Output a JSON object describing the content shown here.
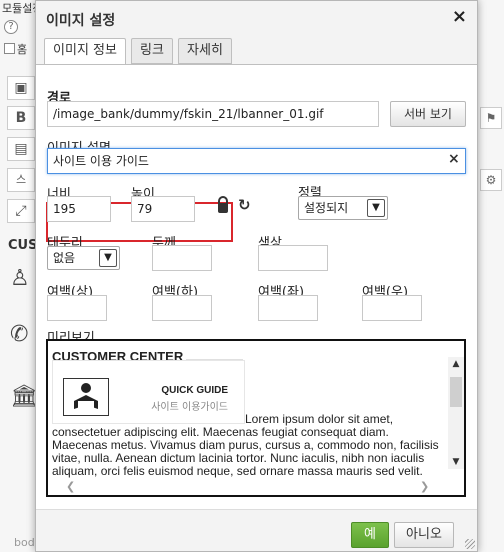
{
  "background": {
    "top_text": "모듈설정(파일관리)",
    "help": "?",
    "home_label": "홈",
    "customer": "CUS",
    "body_tag": "body  p",
    "tool_icons": [
      "source",
      "bold",
      "image",
      "style",
      "expand"
    ]
  },
  "dialog": {
    "title": "이미지 설정",
    "close": "×",
    "tabs": [
      {
        "label": "이미지 정보",
        "active": true
      },
      {
        "label": "링크",
        "active": false
      },
      {
        "label": "자세히",
        "active": false
      }
    ],
    "path": {
      "label": "경로",
      "value": "/image_bank/dummy/fskin_21/lbanner_01.gif",
      "browse_button": "서버 보기"
    },
    "alt": {
      "label": "이미지 설명",
      "value": "사이트 이용 가이드",
      "clear": "×"
    },
    "width": {
      "label": "너비",
      "value": "195"
    },
    "height": {
      "label": "높이",
      "value": "79"
    },
    "align": {
      "label": "정렬",
      "value": "설정되지 "
    },
    "border": {
      "label": "테두리",
      "value": "없음"
    },
    "thickness": {
      "label": "두께",
      "value": ""
    },
    "color": {
      "label": "색상",
      "value": ""
    },
    "margins": [
      {
        "label": "여백(상)",
        "value": ""
      },
      {
        "label": "여백(하)",
        "value": ""
      },
      {
        "label": "여백(좌)",
        "value": ""
      },
      {
        "label": "여백(우)",
        "value": ""
      }
    ],
    "preview": {
      "label": "미리보기",
      "title": "CUSTOMER CENTER",
      "banner_title": "QUICK GUIDE",
      "banner_subtitle": "사이트 이용가이드",
      "lorem_first": "Lorem ipsum dolor sit amet,",
      "lorem_rest": "consectetuer adipiscing elit. Maecenas feugiat consequat diam. Maecenas metus. Vivamus diam purus, cursus a, commodo non, facilisis vitae, nulla. Aenean dictum lacinia tortor. Nunc iaculis, nibh non iaculis aliquam, orci felis euismod neque, sed ornare massa mauris sed velit."
    },
    "footer": {
      "ok": "예",
      "cancel": "아니오"
    }
  },
  "colors": {
    "focus_border": "#4a90e2",
    "highlight_box": "#d9262c",
    "ok_green": "#5aa22e"
  }
}
